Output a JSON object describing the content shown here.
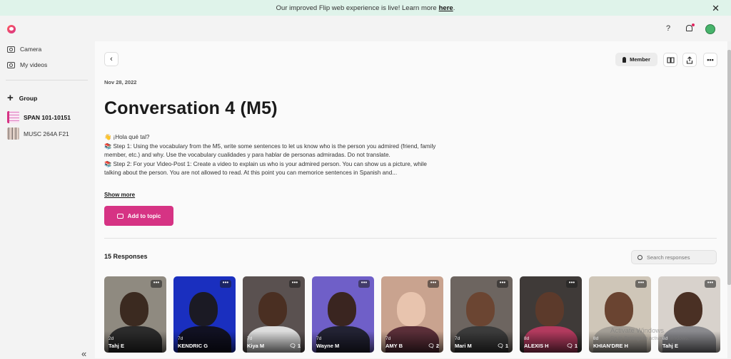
{
  "banner": {
    "text": "Our improved Flip web experience is live! Learn more",
    "link": "here",
    "end": "."
  },
  "topbar": {
    "help_icon": "?"
  },
  "sidebar": {
    "camera": "Camera",
    "my_videos": "My videos",
    "group": "Group",
    "groups": [
      {
        "label": "SPAN 101-10151"
      },
      {
        "label": "MUSC 264A F21"
      }
    ],
    "collapse": "«"
  },
  "main": {
    "back": "‹",
    "member": "Member",
    "date": "Nov 28, 2022",
    "title": "Conversation 4 (M5)",
    "desc_lines": [
      "👋 ¡Hola qué tal?",
      "📚 Step 1: Using the vocabulary from the M5, write some sentences to let us know who is the person you admired (friend, family",
      "member, etc.) and why. Use the vocabulary cualidades y para hablar de personas admiradas. Do not translate.",
      "📚 Step 2: For your Video-Post 1: Create a video to explain us who is your admired person. You can show us a picture, while",
      "talking about the person. You are not allowed to read. At this point you can memorice sentences in Spanish and..."
    ],
    "show_more": "Show more",
    "add_topic": "Add to topic",
    "responses_count": "15 Responses",
    "search_placeholder": "Search responses"
  },
  "responses": [
    {
      "age": "2d",
      "name": "Tahj E",
      "comments": "",
      "bg": "#8f8a80",
      "skin": "#3b2a20",
      "shirt": "#2b2b2b"
    },
    {
      "age": "7d",
      "name": "KENDRIC G",
      "comments": "",
      "bg": "#1a2fbf",
      "skin": "#1b1a24",
      "shirt": "#111122"
    },
    {
      "age": "7d",
      "name": "Kiya M",
      "comments": "1",
      "bg": "#5a5150",
      "skin": "#4a2f22",
      "shirt": "#dcdcdc"
    },
    {
      "age": "7d",
      "name": "Wayne M",
      "comments": "",
      "bg": "#6f5fc8",
      "skin": "#3a2520",
      "shirt": "#222233"
    },
    {
      "age": "7d",
      "name": "AMY B",
      "comments": "2",
      "bg": "#c9a38f",
      "skin": "#e8c4ae",
      "shirt": "#5a2e38"
    },
    {
      "age": "7d",
      "name": "Mari M",
      "comments": "1",
      "bg": "#6d6560",
      "skin": "#6b4532",
      "shirt": "#3b3b3b"
    },
    {
      "age": "8d",
      "name": "ALEXIS H",
      "comments": "1",
      "bg": "#3f3a38",
      "skin": "#5c3a2b",
      "shirt": "#b23a5e"
    },
    {
      "age": "8d",
      "name": "KHIAN'DRE H",
      "comments": "",
      "bg": "#cfc6b8",
      "skin": "#6a4431",
      "shirt": "#a39e96"
    },
    {
      "age": "8d",
      "name": "Tahj E",
      "comments": "",
      "bg": "#d8d2cc",
      "skin": "#4a3024",
      "shirt": "#8a8a8e"
    }
  ],
  "watermark": {
    "line1": "Activate Windows",
    "line2": "Go to Settings to activate Windows."
  },
  "colors": {
    "accent": "#d63384",
    "banner_bg": "#dff3ea"
  }
}
